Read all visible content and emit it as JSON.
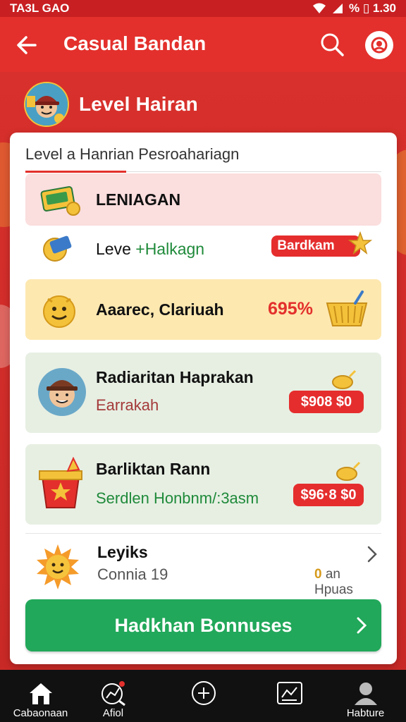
{
  "status_bar": {
    "time": "TA3L GAO",
    "battery": "% ▯ 1.30"
  },
  "app_bar": {
    "title": "Casual Bandan"
  },
  "level_header": {
    "title": "Level Hairan"
  },
  "card": {
    "title": "Level a Hanrian Pesroahariagn",
    "rows": [
      {
        "title": "LENIAGAN"
      },
      {
        "title_plain": "Leve ",
        "title_green": "+Halkagn",
        "badge": "Bardkam"
      },
      {
        "title": "Aaarec, Clariuah",
        "value": "695%"
      },
      {
        "title": "Radiaritan Haprakan",
        "subtitle": "Earrakah",
        "badge": "$908 $0"
      },
      {
        "title": "Barliktan Rann",
        "subtitle": "Serdlen Honbnm/:3asm",
        "badge": "$96·8 $0"
      },
      {
        "title": "Leyiks",
        "subtitle": "Connia 19",
        "extra": "an Hpuas",
        "extra_prefix": "0"
      }
    ],
    "cta": "Hadkhan Bonnuses"
  },
  "bottom_nav": [
    {
      "label": "Cabaonaan"
    },
    {
      "label": "Afiol"
    },
    {
      "label": ""
    },
    {
      "label": ""
    },
    {
      "label": "Habture"
    }
  ],
  "colors": {
    "primary_red": "#e3302c",
    "green_cta": "#21a85a",
    "pink_row": "#fbdede",
    "yellow_row": "#fde8b0",
    "mint_row": "#e7efe3",
    "badge_red": "#e52d2d"
  },
  "icons": {
    "back": "arrow-left-icon",
    "search": "search-icon",
    "profile": "user-icon",
    "home": "home-icon",
    "stats": "chart-icon",
    "add": "plus-circle-icon",
    "shop": "shop-icon",
    "account": "person-icon"
  }
}
